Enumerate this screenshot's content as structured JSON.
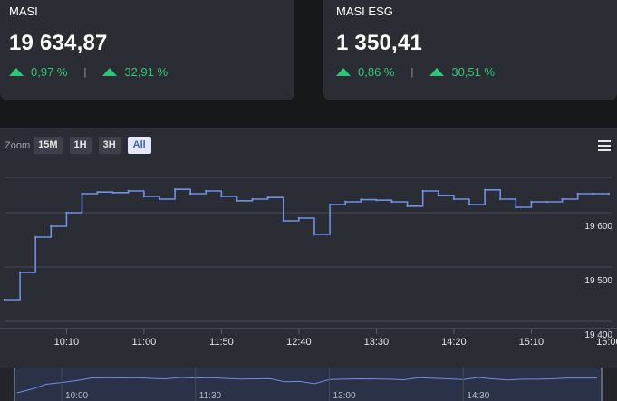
{
  "cards": [
    {
      "name": "MASI",
      "value": "19 634,87",
      "change_day": "0,97 %",
      "change_ytd": "32,91 %"
    },
    {
      "name": "MASI ESG",
      "value": "1 350,41",
      "change_day": "0,86 %",
      "change_ytd": "30,51 %"
    }
  ],
  "toolbar": {
    "zoom_label": "Zoom",
    "buttons": [
      "15M",
      "1H",
      "3H",
      "All"
    ],
    "active_button": "All",
    "menu_icon": "hamburger-menu-icon"
  },
  "colors": {
    "up": "#2ec77a",
    "line": "#6f8fe6",
    "accent": "#3a5fd0"
  },
  "chart_data": {
    "type": "line",
    "series": [
      {
        "x": [
          "09:30",
          "09:40",
          "09:50",
          "10:00",
          "10:10",
          "10:20",
          "10:30",
          "10:40",
          "10:50",
          "11:00",
          "11:10",
          "11:20",
          "11:30",
          "11:40",
          "11:50",
          "12:00",
          "12:10",
          "12:20",
          "12:30",
          "12:40",
          "12:50",
          "13:00",
          "13:10",
          "13:20",
          "13:30",
          "13:40",
          "13:50",
          "14:00",
          "14:10",
          "14:20",
          "14:30",
          "14:40",
          "14:50",
          "15:00",
          "15:10",
          "15:20",
          "15:30",
          "15:40",
          "15:50",
          "16:00"
        ],
        "values": [
          19440,
          19490,
          19555,
          19575,
          19600,
          19635,
          19638,
          19637,
          19640,
          19630,
          19625,
          19643,
          19635,
          19640,
          19630,
          19622,
          19625,
          19628,
          19585,
          19590,
          19560,
          19615,
          19620,
          19624,
          19623,
          19620,
          19612,
          19640,
          19632,
          19625,
          19615,
          19642,
          19625,
          19610,
          19620,
          19620,
          19625,
          19635,
          19635,
          19635
        ]
      }
    ],
    "yticks": [
      "19 400",
      "19 500",
      "19 600"
    ],
    "xticks": [
      "10:10",
      "11:00",
      "11:50",
      "12:40",
      "13:30",
      "14:20",
      "15:10",
      "16:00"
    ],
    "ylim": [
      19380,
      19690
    ],
    "grid": true,
    "navigator": {
      "ticks": [
        "10:00",
        "11:30",
        "13:00",
        "14:30"
      ]
    }
  }
}
